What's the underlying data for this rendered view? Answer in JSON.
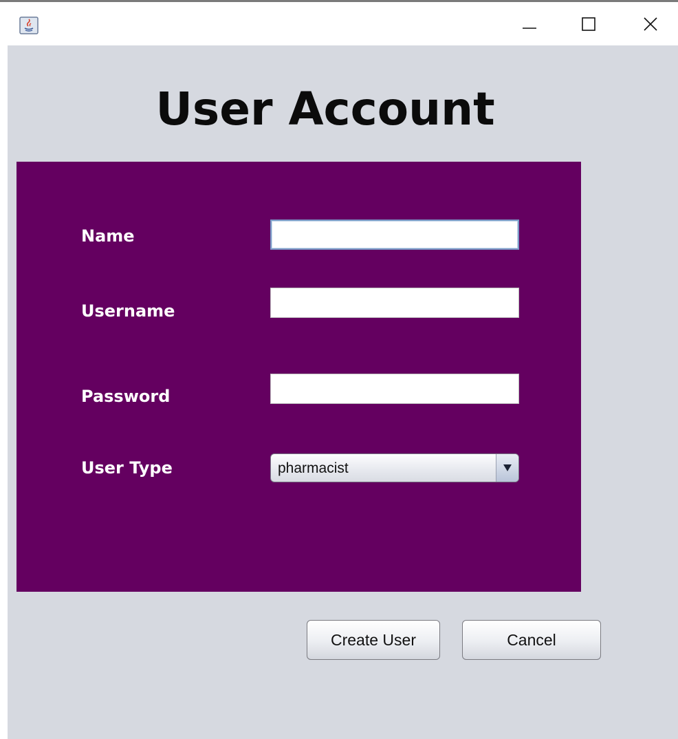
{
  "window": {
    "title": "",
    "icons": {
      "app": "java-app-icon",
      "minimize": "minimize-icon",
      "maximize": "maximize-icon",
      "close": "close-icon"
    }
  },
  "page": {
    "title": "User Account"
  },
  "form": {
    "name": {
      "label": "Name",
      "value": ""
    },
    "username": {
      "label": "Username",
      "value": ""
    },
    "password": {
      "label": "Password",
      "value": ""
    },
    "user_type": {
      "label": "User Type",
      "selected": "pharmacist"
    }
  },
  "actions": {
    "create_label": "Create User",
    "cancel_label": "Cancel"
  },
  "colors": {
    "panel": "#640060",
    "background": "#d6d9e0"
  }
}
